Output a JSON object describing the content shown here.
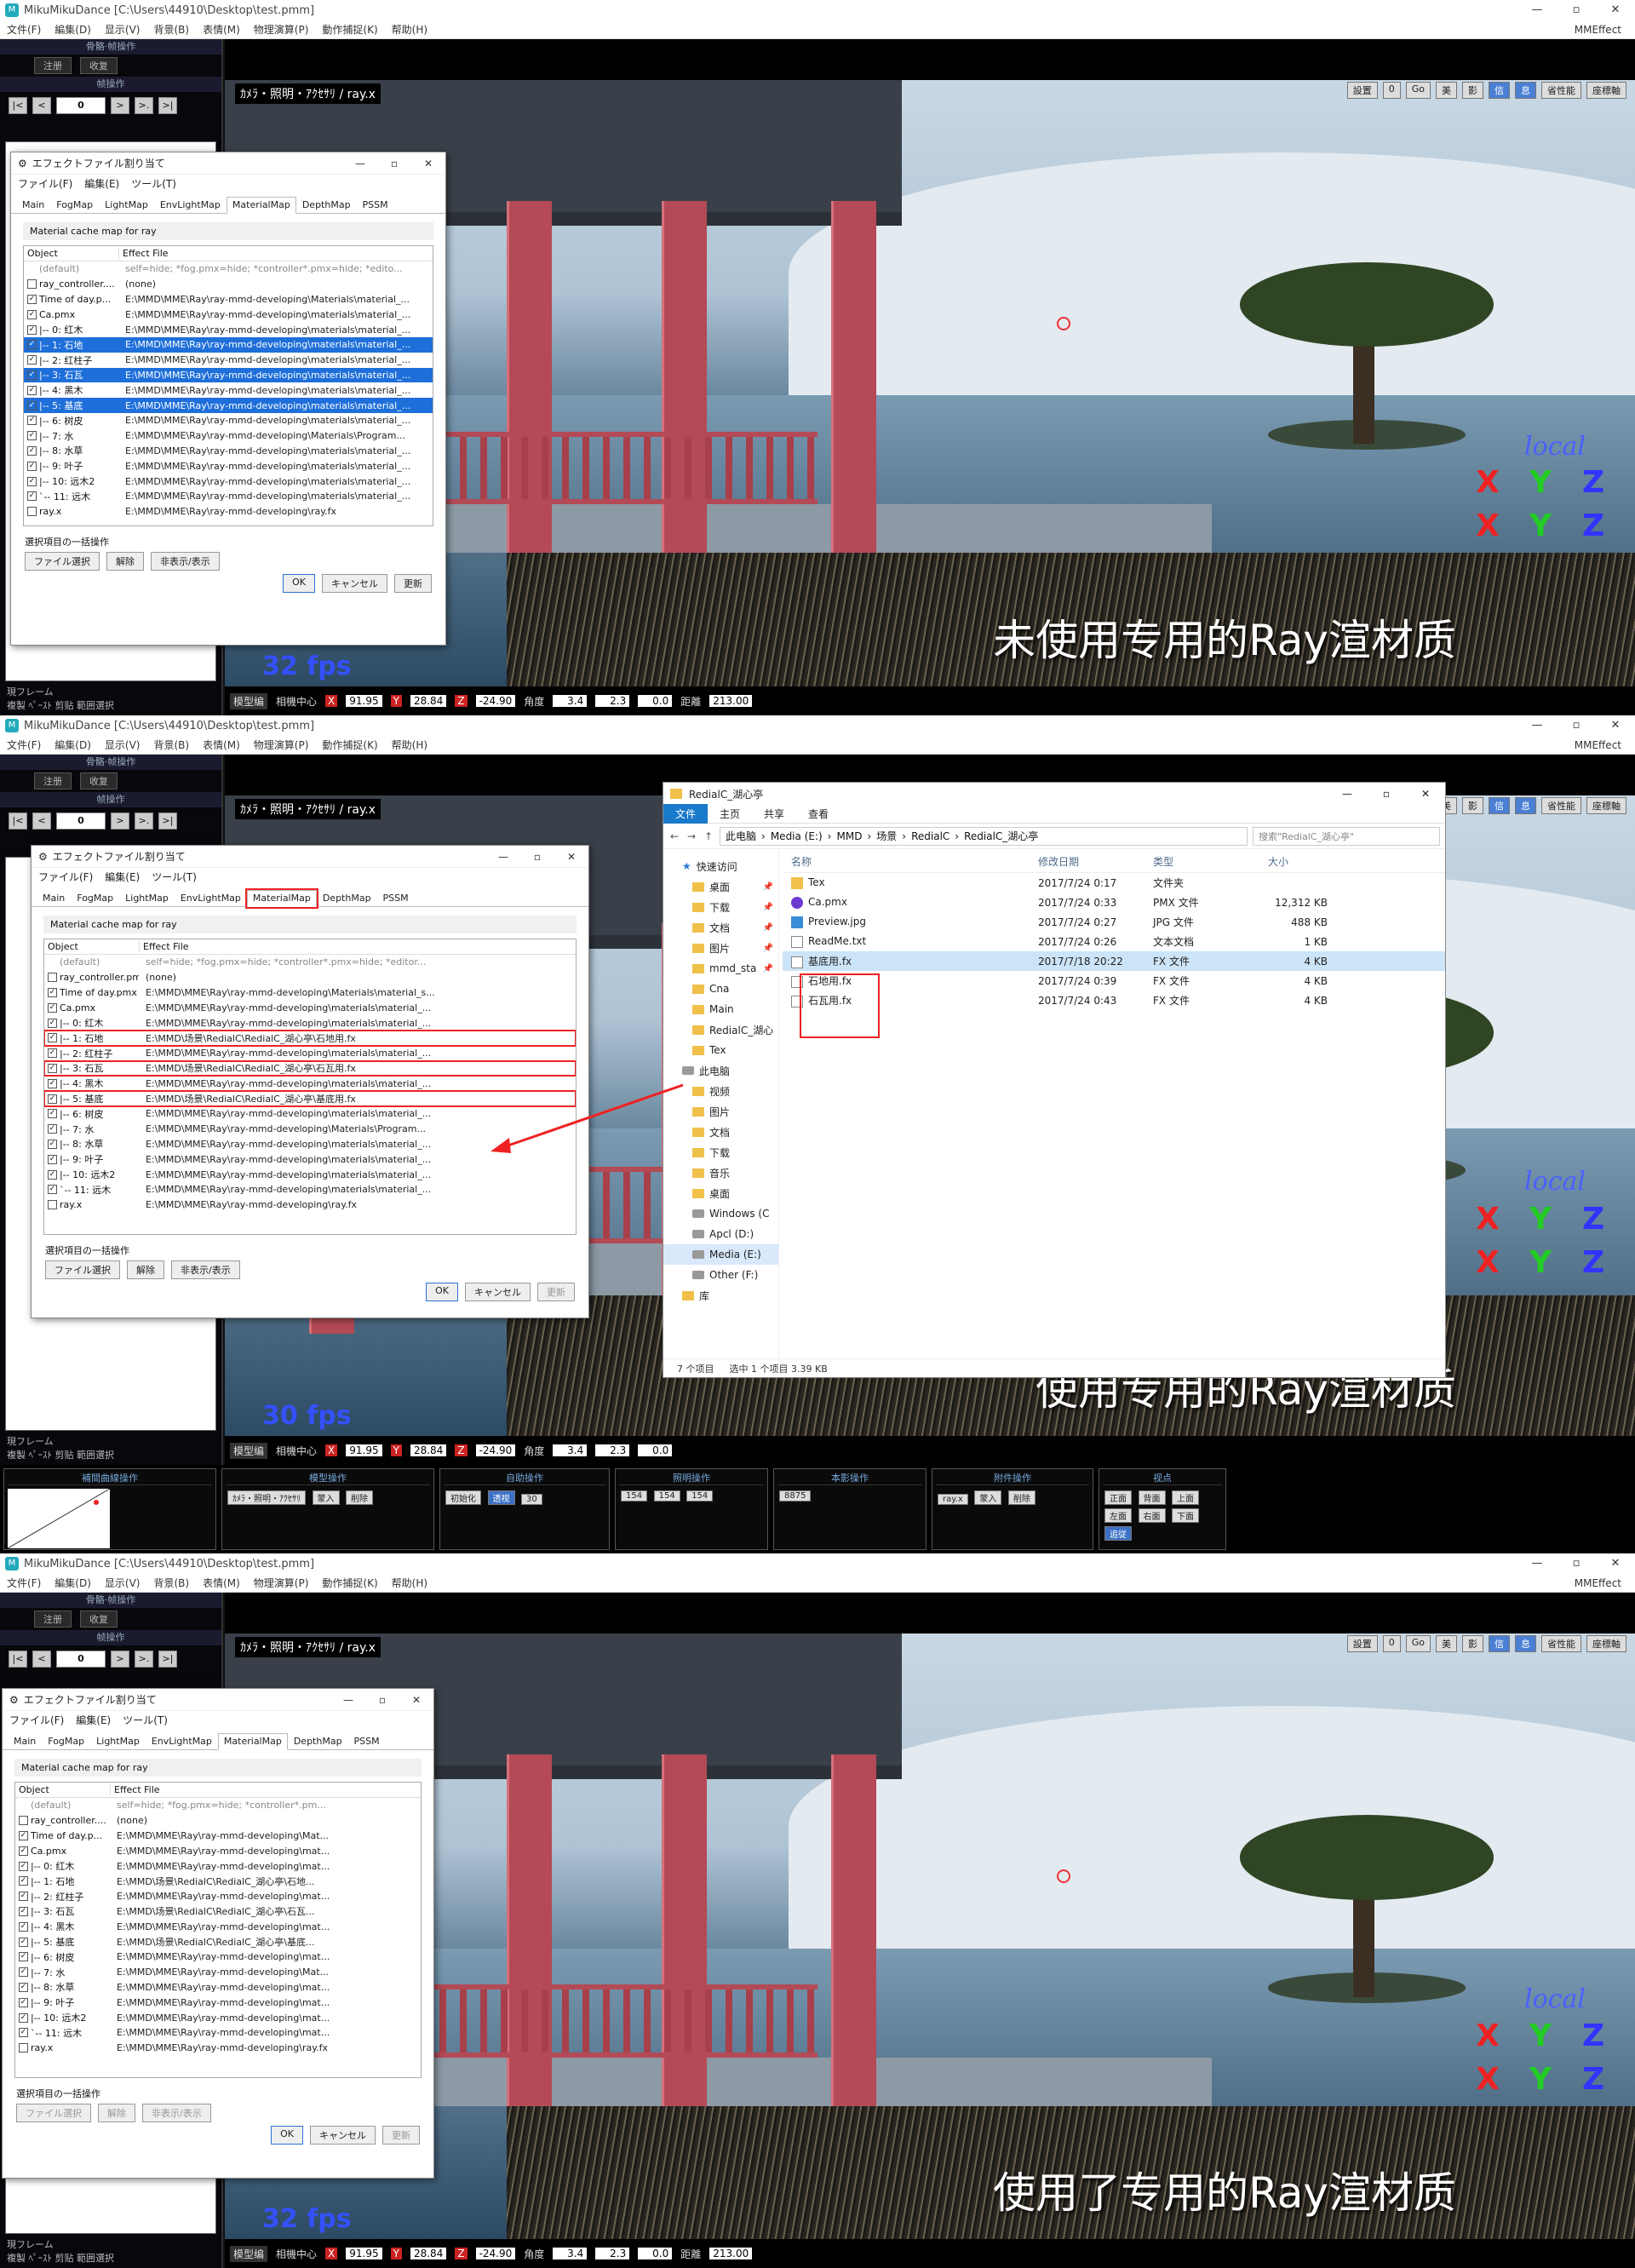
{
  "app": {
    "title": "MikuMikuDance [C:\\Users\\44910\\Desktop\\test.pmm]",
    "menu": [
      "文件(F)",
      "編集(D)",
      "显示(V)",
      "背景(B)",
      "表情(M)",
      "物理演算(P)",
      "動作捕捉(K)",
      "帮助(H)"
    ],
    "mme": "MMEffect",
    "win_controls": [
      "—",
      "▫",
      "✕"
    ]
  },
  "left_pane": {
    "bone_ops": "骨骼·帧操作",
    "reg_btn": "注册",
    "copy_btn": "收复",
    "frame_ops": "帧操作",
    "frame_number": "0",
    "nav": [
      "|<",
      "<",
      "",
      ">",
      ">.",
      ">|"
    ],
    "current_frame": "現フレーム",
    "bottom_btns": [
      "複製",
      "ﾍﾟｰｽﾄ",
      "剪贴",
      "範囲選択"
    ]
  },
  "viewport": {
    "camera_tab": "ｶﾒﾗ・照明・ｱｸｾｻﾘ / ray.x",
    "toolbar": [
      "設置",
      "0",
      "Go",
      "美",
      "影",
      "信",
      "息",
      "省性能",
      "座標軸"
    ],
    "local_label": "local",
    "axes": [
      "X",
      "Y",
      "Z",
      "X",
      "Y",
      "Z"
    ]
  },
  "statusbar": {
    "mode": "模型编",
    "center_label": "相機中心",
    "x": "91.95",
    "y": "28.84",
    "z": "-24.90",
    "angle_label": "角度",
    "ax": "3.4",
    "ay": "2.3",
    "az": "0.0",
    "dist_label": "距離",
    "dist": "213.00",
    "axis_letters": [
      "X",
      "Y",
      "Z"
    ]
  },
  "panels": [
    {
      "caption": "未使用专用的Ray渲材质",
      "fps": "32 fps"
    },
    {
      "caption": "使用专用的Ray渲材质",
      "fps": "30 fps"
    },
    {
      "caption": "使用了专用的Ray渲材质",
      "fps": "32 fps"
    }
  ],
  "dialog": {
    "title": "エフェクトファイル割り当て",
    "menu": [
      "ファイル(F)",
      "編集(E)",
      "ツール(T)"
    ],
    "tabs": [
      "Main",
      "FogMap",
      "LightMap",
      "EnvLightMap",
      "MaterialMap",
      "DepthMap",
      "PSSM"
    ],
    "cache_label": "Material cache map for ray",
    "col_object": "Object",
    "col_effect": "Effect File",
    "batch_label": "選択項目の一括操作",
    "batch_buttons": [
      "ファイル選択",
      "解除",
      "非表示/表示"
    ],
    "ok": "OK",
    "cancel": "キャンセル",
    "update": "更新"
  },
  "rows1": [
    {
      "obj": "(default)",
      "fx": "self=hide; *fog.pmx=hide; *controller*.pmx=hide; *edito...",
      "chk": "none"
    },
    {
      "obj": "ray_controller....",
      "fx": "(none)",
      "chk": "off"
    },
    {
      "obj": "Time of day.p...",
      "fx": "E:\\MMD\\MME\\Ray\\ray-mmd-developing\\Materials\\material_...",
      "chk": "on"
    },
    {
      "obj": "Ca.pmx",
      "fx": "E:\\MMD\\MME\\Ray\\ray-mmd-developing\\materials\\material_...",
      "chk": "on"
    },
    {
      "obj": "|-- 0: 红木",
      "fx": "E:\\MMD\\MME\\Ray\\ray-mmd-developing\\materials\\material_...",
      "chk": "on"
    },
    {
      "obj": "|-- 1: 石地",
      "fx": "E:\\MMD\\MME\\Ray\\ray-mmd-developing\\materials\\material_...",
      "chk": "on",
      "sel": true
    },
    {
      "obj": "|-- 2: 红柱子",
      "fx": "E:\\MMD\\MME\\Ray\\ray-mmd-developing\\materials\\material_...",
      "chk": "on"
    },
    {
      "obj": "|-- 3: 石瓦",
      "fx": "E:\\MMD\\MME\\Ray\\ray-mmd-developing\\materials\\material_...",
      "chk": "on",
      "sel": true
    },
    {
      "obj": "|-- 4: 黑木",
      "fx": "E:\\MMD\\MME\\Ray\\ray-mmd-developing\\materials\\material_...",
      "chk": "on"
    },
    {
      "obj": "|-- 5: 基底",
      "fx": "E:\\MMD\\MME\\Ray\\ray-mmd-developing\\materials\\material_...",
      "chk": "on",
      "sel": true
    },
    {
      "obj": "|-- 6: 树皮",
      "fx": "E:\\MMD\\MME\\Ray\\ray-mmd-developing\\materials\\material_...",
      "chk": "on"
    },
    {
      "obj": "|-- 7: 水",
      "fx": "E:\\MMD\\MME\\Ray\\ray-mmd-developing\\Materials\\Program...",
      "chk": "on"
    },
    {
      "obj": "|-- 8: 水草",
      "fx": "E:\\MMD\\MME\\Ray\\ray-mmd-developing\\materials\\material_...",
      "chk": "on"
    },
    {
      "obj": "|-- 9: 叶子",
      "fx": "E:\\MMD\\MME\\Ray\\ray-mmd-developing\\materials\\material_...",
      "chk": "on"
    },
    {
      "obj": "|-- 10: 远木2",
      "fx": "E:\\MMD\\MME\\Ray\\ray-mmd-developing\\materials\\material_...",
      "chk": "on"
    },
    {
      "obj": "`-- 11: 远木",
      "fx": "E:\\MMD\\MME\\Ray\\ray-mmd-developing\\materials\\material_...",
      "chk": "on"
    },
    {
      "obj": "ray.x",
      "fx": "E:\\MMD\\MME\\Ray\\ray-mmd-developing\\ray.fx",
      "chk": "off"
    }
  ],
  "rows2": [
    {
      "obj": "(default)",
      "fx": "self=hide; *fog.pmx=hide; *controller*.pmx=hide; *editor...",
      "chk": "none"
    },
    {
      "obj": "ray_controller.pmx",
      "fx": "(none)",
      "chk": "off"
    },
    {
      "obj": "Time of day.pmx",
      "fx": "E:\\MMD\\MME\\Ray\\ray-mmd-developing\\Materials\\material_s...",
      "chk": "on"
    },
    {
      "obj": "Ca.pmx",
      "fx": "E:\\MMD\\MME\\Ray\\ray-mmd-developing\\materials\\material_...",
      "chk": "on"
    },
    {
      "obj": "|-- 0: 红木",
      "fx": "E:\\MMD\\MME\\Ray\\ray-mmd-developing\\materials\\material_...",
      "chk": "on"
    },
    {
      "obj": "|-- 1: 石地",
      "fx": "E:\\MMD\\场景\\RedialC\\RedialC_湖心亭\\石地用.fx",
      "chk": "on",
      "boxed": true
    },
    {
      "obj": "|-- 2: 红柱子",
      "fx": "E:\\MMD\\MME\\Ray\\ray-mmd-developing\\materials\\material_...",
      "chk": "on"
    },
    {
      "obj": "|-- 3: 石瓦",
      "fx": "E:\\MMD\\场景\\RedialC\\RedialC_湖心亭\\石瓦用.fx",
      "chk": "on",
      "boxed": true
    },
    {
      "obj": "|-- 4: 黑木",
      "fx": "E:\\MMD\\MME\\Ray\\ray-mmd-developing\\materials\\material_...",
      "chk": "on"
    },
    {
      "obj": "|-- 5: 基底",
      "fx": "E:\\MMD\\场景\\RedialC\\RedialC_湖心亭\\基底用.fx",
      "chk": "on",
      "boxed": true
    },
    {
      "obj": "|-- 6: 树皮",
      "fx": "E:\\MMD\\MME\\Ray\\ray-mmd-developing\\materials\\material_...",
      "chk": "on"
    },
    {
      "obj": "|-- 7: 水",
      "fx": "E:\\MMD\\MME\\Ray\\ray-mmd-developing\\Materials\\Program...",
      "chk": "on"
    },
    {
      "obj": "|-- 8: 水草",
      "fx": "E:\\MMD\\MME\\Ray\\ray-mmd-developing\\materials\\material_...",
      "chk": "on"
    },
    {
      "obj": "|-- 9: 叶子",
      "fx": "E:\\MMD\\MME\\Ray\\ray-mmd-developing\\materials\\material_...",
      "chk": "on"
    },
    {
      "obj": "|-- 10: 远木2",
      "fx": "E:\\MMD\\MME\\Ray\\ray-mmd-developing\\materials\\material_...",
      "chk": "on"
    },
    {
      "obj": "`-- 11: 远木",
      "fx": "E:\\MMD\\MME\\Ray\\ray-mmd-developing\\materials\\material_...",
      "chk": "on"
    },
    {
      "obj": "ray.x",
      "fx": "E:\\MMD\\MME\\Ray\\ray-mmd-developing\\ray.fx",
      "chk": "off"
    }
  ],
  "rows3": [
    {
      "obj": "(default)",
      "fx": "self=hide; *fog.pmx=hide; *controller*.pm...",
      "chk": "none"
    },
    {
      "obj": "ray_controller....",
      "fx": "(none)",
      "chk": "off"
    },
    {
      "obj": "Time of day.p...",
      "fx": "E:\\MMD\\MME\\Ray\\ray-mmd-developing\\Mat...",
      "chk": "on"
    },
    {
      "obj": "Ca.pmx",
      "fx": "E:\\MMD\\MME\\Ray\\ray-mmd-developing\\mat...",
      "chk": "on"
    },
    {
      "obj": "|-- 0: 红木",
      "fx": "E:\\MMD\\MME\\Ray\\ray-mmd-developing\\mat...",
      "chk": "on"
    },
    {
      "obj": "|-- 1: 石地",
      "fx": "E:\\MMD\\场景\\RedialC\\RedialC_湖心亭\\石地...",
      "chk": "on"
    },
    {
      "obj": "|-- 2: 红柱子",
      "fx": "E:\\MMD\\MME\\Ray\\ray-mmd-developing\\mat...",
      "chk": "on"
    },
    {
      "obj": "|-- 3: 石瓦",
      "fx": "E:\\MMD\\场景\\RedialC\\RedialC_湖心亭\\石瓦...",
      "chk": "on"
    },
    {
      "obj": "|-- 4: 黑木",
      "fx": "E:\\MMD\\MME\\Ray\\ray-mmd-developing\\mat...",
      "chk": "on"
    },
    {
      "obj": "|-- 5: 基底",
      "fx": "E:\\MMD\\场景\\RedialC\\RedialC_湖心亭\\基底...",
      "chk": "on"
    },
    {
      "obj": "|-- 6: 树皮",
      "fx": "E:\\MMD\\MME\\Ray\\ray-mmd-developing\\mat...",
      "chk": "on"
    },
    {
      "obj": "|-- 7: 水",
      "fx": "E:\\MMD\\MME\\Ray\\ray-mmd-developing\\Mat...",
      "chk": "on"
    },
    {
      "obj": "|-- 8: 水草",
      "fx": "E:\\MMD\\MME\\Ray\\ray-mmd-developing\\mat...",
      "chk": "on"
    },
    {
      "obj": "|-- 9: 叶子",
      "fx": "E:\\MMD\\MME\\Ray\\ray-mmd-developing\\mat...",
      "chk": "on"
    },
    {
      "obj": "|-- 10: 远木2",
      "fx": "E:\\MMD\\MME\\Ray\\ray-mmd-developing\\mat...",
      "chk": "on"
    },
    {
      "obj": "`-- 11: 远木",
      "fx": "E:\\MMD\\MME\\Ray\\ray-mmd-developing\\mat...",
      "chk": "on"
    },
    {
      "obj": "ray.x",
      "fx": "E:\\MMD\\MME\\Ray\\ray-mmd-developing\\ray.fx",
      "chk": "off"
    }
  ],
  "explorer": {
    "title": "RedialC_湖心亭",
    "ribbon": [
      "文件",
      "主页",
      "共享",
      "查看"
    ],
    "path": [
      "此电脑",
      "Media (E:)",
      "MMD",
      "场景",
      "RedialC",
      "RedialC_湖心亭"
    ],
    "search_placeholder": "搜索\"RedialC_湖心亭\"",
    "cols": [
      "名称",
      "修改日期",
      "类型",
      "大小"
    ],
    "sidebar": [
      {
        "label": "快速访问",
        "icon": "star",
        "sub": false
      },
      {
        "label": "桌面",
        "icon": "fold",
        "sub": true,
        "pin": true
      },
      {
        "label": "下载",
        "icon": "fold",
        "sub": true,
        "pin": true
      },
      {
        "label": "文档",
        "icon": "fold",
        "sub": true,
        "pin": true
      },
      {
        "label": "图片",
        "icon": "fold",
        "sub": true,
        "pin": true
      },
      {
        "label": "mmd_sta",
        "icon": "fold",
        "sub": true,
        "pin": true
      },
      {
        "label": "Cna",
        "icon": "fold",
        "sub": true
      },
      {
        "label": "Main",
        "icon": "fold",
        "sub": true
      },
      {
        "label": "RedialC_湖心",
        "icon": "fold",
        "sub": true
      },
      {
        "label": "Tex",
        "icon": "fold",
        "sub": true
      },
      {
        "label": "此电脑",
        "icon": "disk",
        "sub": false
      },
      {
        "label": "视频",
        "icon": "fold",
        "sub": true
      },
      {
        "label": "图片",
        "icon": "fold",
        "sub": true
      },
      {
        "label": "文档",
        "icon": "fold",
        "sub": true
      },
      {
        "label": "下载",
        "icon": "fold",
        "sub": true
      },
      {
        "label": "音乐",
        "icon": "fold",
        "sub": true
      },
      {
        "label": "桌面",
        "icon": "fold",
        "sub": true
      },
      {
        "label": "Windows (C",
        "icon": "disk",
        "sub": true
      },
      {
        "label": "Apcl (D:)",
        "icon": "disk",
        "sub": true
      },
      {
        "label": "Media (E:)",
        "icon": "disk",
        "sub": true,
        "active": true
      },
      {
        "label": "Other (F:)",
        "icon": "disk",
        "sub": true
      },
      {
        "label": "库",
        "icon": "fold",
        "sub": false
      }
    ],
    "files": [
      {
        "name": "Tex",
        "date": "2017/7/24 0:17",
        "type": "文件夹",
        "size": "",
        "icon": "fold"
      },
      {
        "name": "Ca.pmx",
        "date": "2017/7/24 0:33",
        "type": "PMX 文件",
        "size": "12,312 KB",
        "icon": "pmx"
      },
      {
        "name": "Preview.jpg",
        "date": "2017/7/24 0:27",
        "type": "JPG 文件",
        "size": "488 KB",
        "icon": "img"
      },
      {
        "name": "ReadMe.txt",
        "date": "2017/7/24 0:26",
        "type": "文本文档",
        "size": "1 KB",
        "icon": "doc"
      },
      {
        "name": "基底用.fx",
        "date": "2017/7/18 20:22",
        "type": "FX 文件",
        "size": "4 KB",
        "icon": "doc",
        "sel": true
      },
      {
        "name": "石地用.fx",
        "date": "2017/7/24 0:39",
        "type": "FX 文件",
        "size": "4 KB",
        "icon": "doc"
      },
      {
        "name": "石瓦用.fx",
        "date": "2017/7/24 0:43",
        "type": "FX 文件",
        "size": "4 KB",
        "icon": "doc"
      }
    ],
    "status": [
      "7 个项目",
      "选中 1 个项目 3.39 KB"
    ]
  },
  "ctrl": {
    "blocks": [
      "補間曲線操作",
      "模型操作",
      "自助操作",
      "照明操作",
      "本影操作",
      "附件操作",
      "视点"
    ],
    "model_select": "ｶﾒﾗ・照明・ｱｸｾｻﾘ",
    "init": "初始化",
    "persp": "透视",
    "reg": "蒙入",
    "delete": "削除",
    "anchor": "ray.x",
    "views": [
      "正面",
      "背面",
      "上面",
      "左面",
      "右面",
      "下面",
      "追従"
    ],
    "values": [
      "154",
      "154",
      "154",
      "8875",
      "30"
    ]
  },
  "colors": {
    "accent": "#1e6fd9",
    "highlight": "#e22222",
    "fps": "#3450ff"
  }
}
